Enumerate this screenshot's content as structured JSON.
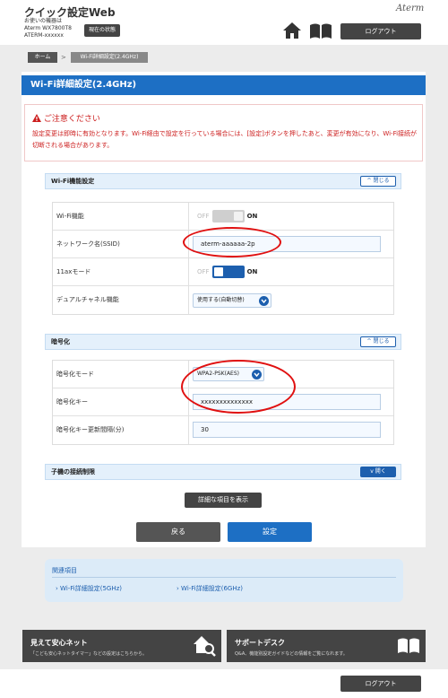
{
  "header": {
    "app_title": "クイック設定Web",
    "device_line1": "お使いの機器は",
    "device_line2": "Aterm WX7800T8",
    "device_line3": "ATERM-xxxxxx",
    "status_button": "現在の状態",
    "brand": "Aterm",
    "logout": "ログアウト",
    "home_icon": "home-icon",
    "book_icon": "book-icon"
  },
  "breadcrumb": {
    "home": "ホーム",
    "separator": ">",
    "current": "Wi-Fi詳細設定(2.4GHz)"
  },
  "page": {
    "title": "Wi-Fi詳細設定(2.4GHz)"
  },
  "notice": {
    "title": "ご注意ください",
    "text": "設定変更は即時に有効となります。Wi-Fi経由で設定を行っている場合には、[設定]ボタンを押したあと、変更が有効になり、Wi-Fi接続が切断される場合があります。"
  },
  "section_wifi": {
    "title": "Wi-Fi機能設定",
    "collapse": "閉じる",
    "wifi_label": "Wi-Fi機能",
    "wifi_off": "OFF",
    "wifi_on": "ON",
    "wifi_enabled": false,
    "ssid_label": "ネットワーク名(SSID)",
    "ssid_value": "aterm-aaaaaa-2p",
    "ax_label": "11axモード",
    "ax_off": "OFF",
    "ax_on": "ON",
    "ax_enabled": true,
    "dual_label": "デュアルチャネル機能",
    "dual_value": "使用する(自動切替)"
  },
  "section_crypto": {
    "title": "暗号化",
    "collapse": "閉じる",
    "mode_label": "暗号化モード",
    "mode_value": "WPA2-PSK(AES)",
    "key_label": "暗号化キー",
    "key_value": "xxxxxxxxxxxxxx",
    "interval_label": "暗号化キー更新間隔(分)",
    "interval_value": "30"
  },
  "section_child": {
    "title": "子機の接続制限",
    "expand": "開く"
  },
  "actions": {
    "detail": "詳細な項目を表示",
    "back": "戻る",
    "set": "設定"
  },
  "related": {
    "title": "関連項目",
    "link1": "Wi-Fi詳細設定(5GHz)",
    "link2": "Wi-Fi詳細設定(6GHz)"
  },
  "banners": {
    "left_title": "見えて安心ネット",
    "left_sub": "「こども安心ネットタイマー」などの設定はこちらから。",
    "right_title": "サポートデスク",
    "right_sub": "Q&A、機能別設定ガイドなどの情報をご覧になれます。"
  },
  "footer": {
    "logout": "ログアウト"
  },
  "colors": {
    "accent": "#1d6fc4",
    "warning": "#cc1d1d",
    "dark_button": "#444444",
    "highlight_ring": "#e01010"
  }
}
